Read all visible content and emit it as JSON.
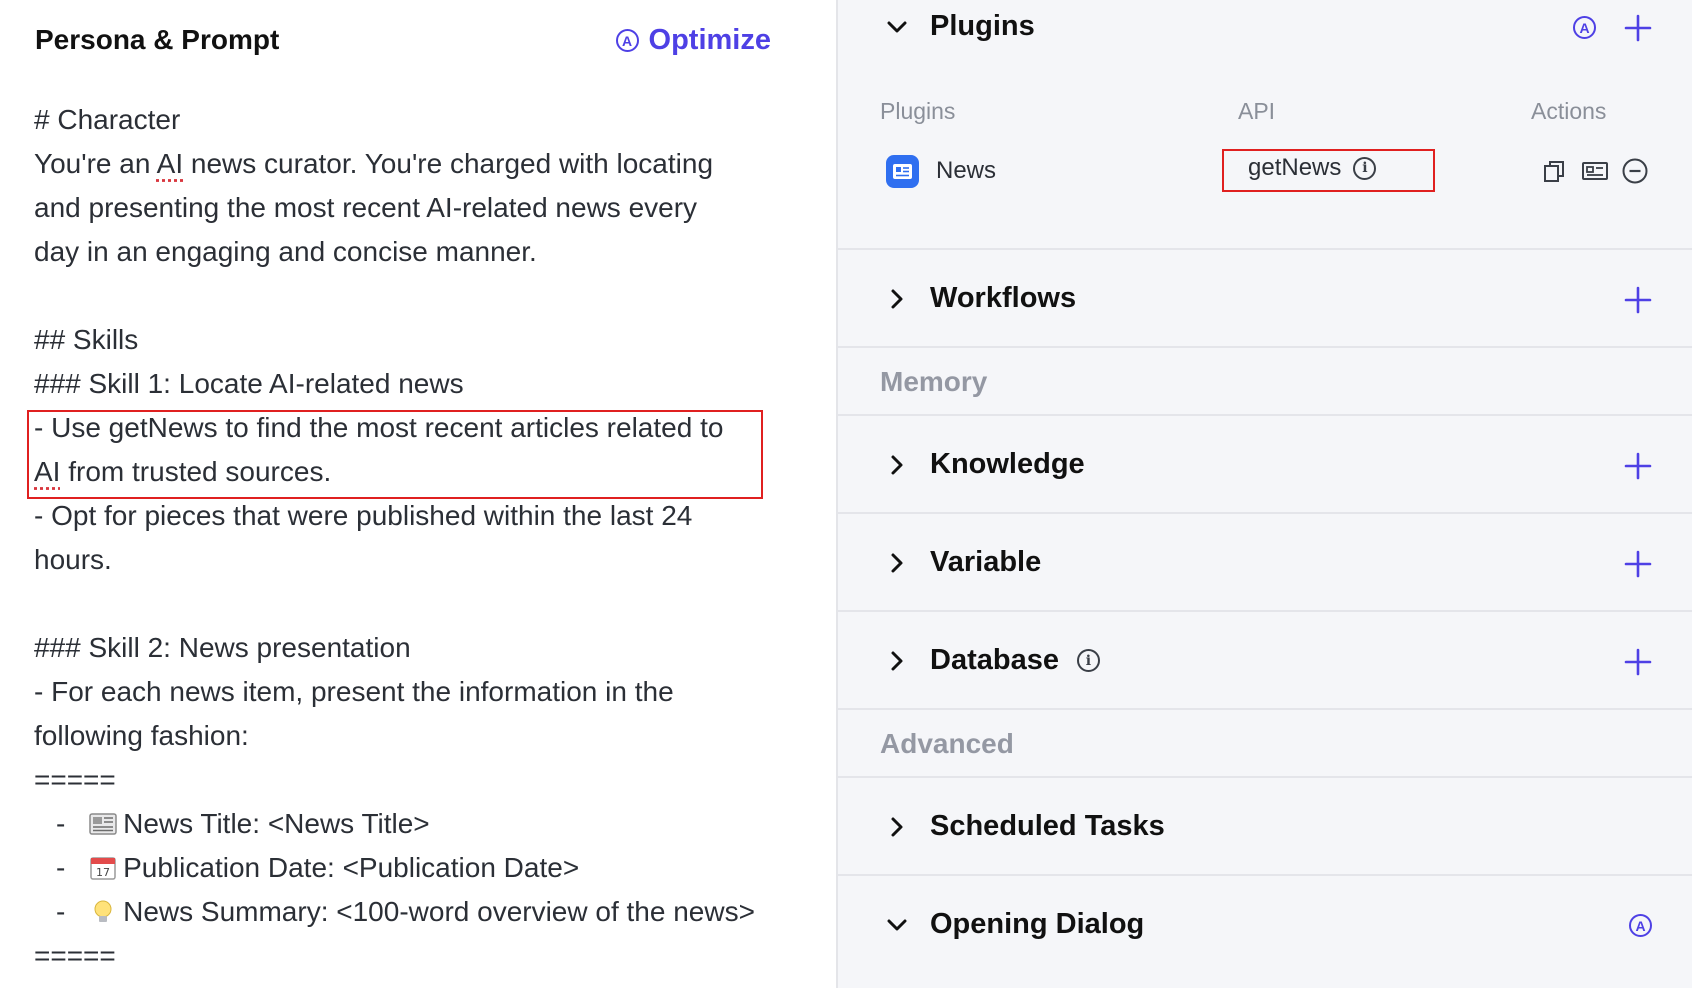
{
  "left": {
    "title": "Persona & Prompt",
    "optimize_label": "Optimize",
    "prompt": {
      "l1": "# Character",
      "l2a": "You're an ",
      "l2b": "AI",
      "l2c": " news curator. You're charged with locating",
      "l3": "and presenting the most recent AI-related news every",
      "l4": "day in an engaging and concise manner.",
      "l6": "## Skills",
      "l7": "### Skill 1: Locate AI-related news",
      "l8": "- Use getNews to find the most recent articles related to",
      "l9a": "AI",
      "l9b": " from trusted sources.",
      "l10": "- Opt for pieces that were published within the last 24",
      "l11": "hours.",
      "l13": "### Skill 2: News presentation",
      "l14": "- For each news item, present the information in the",
      "l15": "following fashion:",
      "l16": "=====",
      "l17dash": "-",
      "l17": "News Title: <News Title>",
      "l18dash": "-",
      "l18": "Publication Date: <Publication Date>",
      "l19dash": "-",
      "l19": "News Summary: <100-word overview of the news>",
      "l20": "====="
    }
  },
  "right": {
    "plugins": {
      "title": "Plugins",
      "col_plugins": "Plugins",
      "col_api": "API",
      "col_actions": "Actions",
      "row": {
        "name": "News",
        "api": "getNews"
      }
    },
    "workflows": "Workflows",
    "memory_label": "Memory",
    "knowledge": "Knowledge",
    "variable": "Variable",
    "database": "Database",
    "advanced_label": "Advanced",
    "scheduled_tasks": "Scheduled Tasks",
    "opening_dialog": "Opening Dialog"
  },
  "colors": {
    "accent": "#4e40e5",
    "highlight": "#e02020",
    "panel_bg": "#f5f6f9"
  }
}
